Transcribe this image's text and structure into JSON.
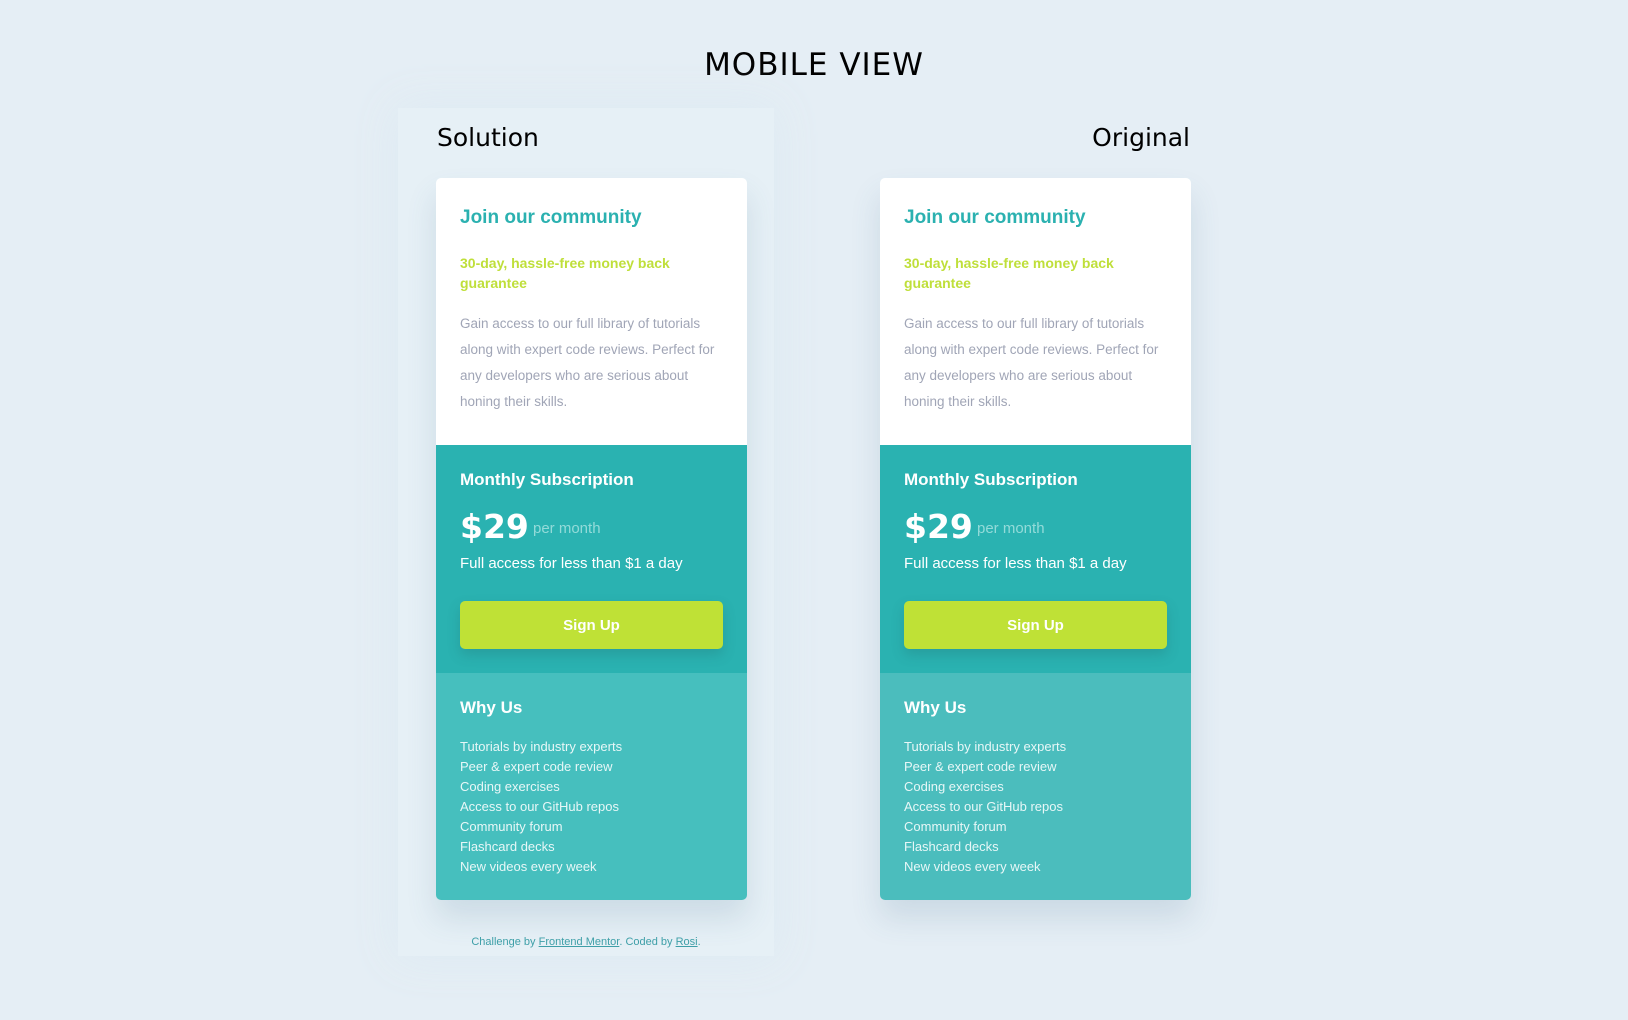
{
  "page": {
    "title": "MOBILE VIEW"
  },
  "labels": {
    "solution": "Solution",
    "original": "Original"
  },
  "cards": {
    "solution": {
      "heading": "Join our community",
      "guarantee": "30-day, hassle-free money back guarantee",
      "description": "Gain access to our full library of tutorials along with expert code reviews. Perfect for any developers who are serious about honing their skills.",
      "subscription_title": "Monthly Subscription",
      "price": "$29",
      "per_month": "per month",
      "access_note": "Full access for less than $1 a day",
      "signup_label": "Sign Up",
      "why_title": "Why Us",
      "why_items": [
        "Tutorials by industry experts",
        "Peer & expert code review",
        "Coding exercises",
        "Access to our GitHub repos",
        "Community forum",
        "Flashcard decks",
        "New videos every week"
      ]
    },
    "original": {
      "heading": "Join our community",
      "guarantee": "30-day, hassle-free money back guarantee",
      "description": "Gain access to our full library of tutorials along with expert code reviews. Perfect for any developers who are serious about honing their skills.",
      "subscription_title": "Monthly Subscription",
      "price": "$29",
      "per_month": "per month",
      "access_note": "Full access for less than $1 a day",
      "signup_label": "Sign Up",
      "why_title": "Why Us",
      "why_items": [
        "Tutorials by industry experts",
        "Peer & expert code review",
        "Coding exercises",
        "Access to our GitHub repos",
        "Community forum",
        "Flashcard decks",
        "New videos every week"
      ]
    }
  },
  "footer": {
    "prefix": "Challenge by ",
    "mentor_link": "Frontend Mentor",
    "middle": ". Coded by ",
    "author_link": "Rosi",
    "suffix": "."
  },
  "colors": {
    "page_background": "#e5eef5",
    "heading_teal": "#2bb1b0",
    "guarantee_lime": "#bfdf3a",
    "body_gray": "#a0a5b6",
    "middle_teal": "#2ab2b1",
    "bottom_teal": "#46bfbe",
    "button_lime": "#bfe136"
  }
}
